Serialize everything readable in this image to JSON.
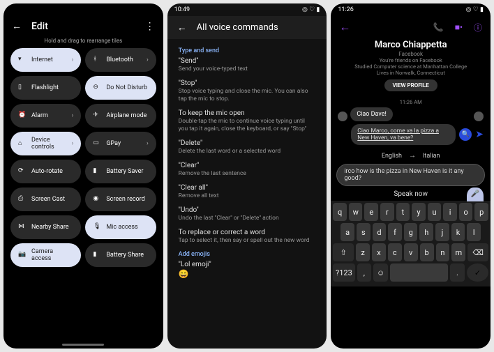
{
  "phone1": {
    "header": {
      "title": "Edit"
    },
    "hint": "Hold and drag to rearrange tiles",
    "tiles": [
      {
        "label": "Internet",
        "active": true,
        "chevron": true,
        "icon": "wifi-icon"
      },
      {
        "label": "Bluetooth",
        "active": false,
        "chevron": true,
        "icon": "bluetooth-icon"
      },
      {
        "label": "Flashlight",
        "active": false,
        "chevron": false,
        "icon": "flashlight-icon"
      },
      {
        "label": "Do Not Disturb",
        "active": true,
        "chevron": false,
        "icon": "dnd-icon"
      },
      {
        "label": "Alarm",
        "active": false,
        "chevron": true,
        "icon": "alarm-icon"
      },
      {
        "label": "Airplane mode",
        "active": false,
        "chevron": false,
        "icon": "airplane-icon"
      },
      {
        "label": "Device controls",
        "active": true,
        "chevron": true,
        "icon": "home-icon"
      },
      {
        "label": "GPay",
        "active": false,
        "chevron": true,
        "icon": "card-icon"
      },
      {
        "label": "Auto-rotate",
        "active": false,
        "chevron": false,
        "icon": "rotate-icon"
      },
      {
        "label": "Battery Saver",
        "active": false,
        "chevron": false,
        "icon": "battery-icon"
      },
      {
        "label": "Screen Cast",
        "active": false,
        "chevron": false,
        "icon": "cast-icon"
      },
      {
        "label": "Screen record",
        "active": false,
        "chevron": false,
        "icon": "record-icon"
      },
      {
        "label": "Nearby Share",
        "active": false,
        "chevron": false,
        "icon": "share-icon"
      },
      {
        "label": "Mic access",
        "active": true,
        "chevron": false,
        "icon": "mic-icon"
      },
      {
        "label": "Camera access",
        "active": true,
        "chevron": false,
        "icon": "camera-icon"
      },
      {
        "label": "Battery Share",
        "active": false,
        "chevron": false,
        "icon": "battery-share-icon"
      }
    ]
  },
  "phone2": {
    "time": "10:49",
    "header": {
      "title": "All voice commands"
    },
    "section1": "Type and send",
    "items": [
      {
        "cmd": "\"Send\"",
        "desc": "Send your voice-typed text"
      },
      {
        "cmd": "\"Stop\"",
        "desc": "Stop voice typing and close the mic. You can also tap the mic to stop."
      },
      {
        "cmd": "To keep the mic open",
        "desc": "Double-tap the mic to continue voice typing until you tap it again, close the keyboard, or say \"Stop\""
      },
      {
        "cmd": "\"Delete\"",
        "desc": "Delete the last word or a selected word"
      },
      {
        "cmd": "\"Clear\"",
        "desc": "Remove the last sentence"
      },
      {
        "cmd": "\"Clear all\"",
        "desc": "Remove all text"
      },
      {
        "cmd": "\"Undo\"",
        "desc": "Undo the last \"Clear\" or \"Delete\" action"
      },
      {
        "cmd": "To replace or correct a word",
        "desc": "Tap to select it, then say or spell out the new word"
      }
    ],
    "section2": "Add emojis",
    "emoji_cmd": "\"Lol emoji\"",
    "emoji_glyph": "😄"
  },
  "phone3": {
    "time": "11:26",
    "profile": {
      "name": "Marco Chiappetta",
      "platform": "Facebook",
      "line1": "You're friends on Facebook",
      "line2": "Studied Computer science at Manhattan College",
      "line3": "Lives in Norwalk, Connecticut",
      "button": "VIEW PROFILE"
    },
    "chat_time": "11:26 AM",
    "msg_in": "Ciao Dave!",
    "msg_out": "Ciao Marco, come va la pizza a New Haven, va bene?",
    "lang_from": "English",
    "lang_to": "Italian",
    "input_text": "irco how is the pizza in New Haven is it any good?",
    "speak_label": "Speak now",
    "keyboard": {
      "row1": [
        "q",
        "w",
        "e",
        "r",
        "t",
        "y",
        "u",
        "i",
        "o",
        "p"
      ],
      "row2": [
        "a",
        "s",
        "d",
        "f",
        "g",
        "h",
        "j",
        "k",
        "l"
      ],
      "row3_shift": "⇧",
      "row3": [
        "z",
        "x",
        "c",
        "v",
        "b",
        "n",
        "m"
      ],
      "row3_del": "⌫",
      "row4_sym": "?123",
      "row4_comma": ",",
      "row4_emoji": "☺",
      "row4_period": ".",
      "row4_enter": "✓"
    }
  }
}
